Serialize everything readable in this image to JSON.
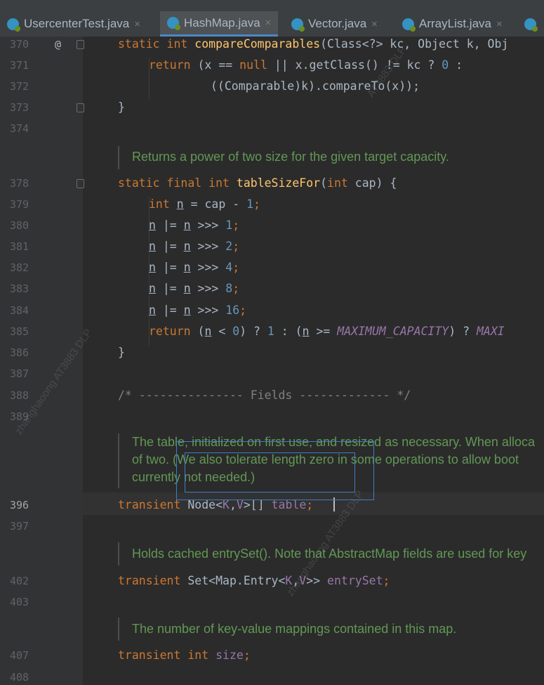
{
  "tabs": [
    {
      "label": "UsercenterTest.java",
      "close": "×",
      "active": false
    },
    {
      "label": "HashMap.java",
      "close": "×",
      "active": true
    },
    {
      "label": "Vector.java",
      "close": "×",
      "active": false
    },
    {
      "label": "ArrayList.java",
      "close": "×",
      "active": false
    }
  ],
  "gutter": {
    "line_numbers": [
      "370",
      "371",
      "372",
      "373",
      "374",
      "378",
      "379",
      "380",
      "381",
      "382",
      "383",
      "384",
      "385",
      "386",
      "387",
      "388",
      "389",
      "396",
      "397",
      "402",
      "403",
      "407",
      "408"
    ],
    "current_line": "396",
    "override_marker": "@"
  },
  "code": {
    "l370": [
      "static int ",
      "compareComparables",
      "(Class<?> kc, Object k, Obj"
    ],
    "l371": [
      "return ",
      "(x == ",
      "null",
      " || x.getClass() != kc ? ",
      "0",
      " :"
    ],
    "l372": [
      "((Comparable)k).compareTo(x));"
    ],
    "l373": [
      "}"
    ],
    "l378": [
      "static final int ",
      "tableSizeFor",
      "(",
      "int ",
      "cap) {"
    ],
    "l379": [
      "int ",
      "n",
      " = cap - ",
      "1",
      ";"
    ],
    "l380": [
      "n",
      " |= ",
      "n",
      " >>> ",
      "1",
      ";"
    ],
    "l381": [
      "n",
      " |= ",
      "n",
      " >>> ",
      "2",
      ";"
    ],
    "l382": [
      "n",
      " |= ",
      "n",
      " >>> ",
      "4",
      ";"
    ],
    "l383": [
      "n",
      " |= ",
      "n",
      " >>> ",
      "8",
      ";"
    ],
    "l384": [
      "n",
      " |= ",
      "n",
      " >>> ",
      "16",
      ";"
    ],
    "l385": [
      "return ",
      "(",
      "n",
      " < ",
      "0",
      ") ? ",
      "1",
      " : (",
      "n",
      " >= ",
      "MAXIMUM_CAPACITY",
      ") ? ",
      "MAXI"
    ],
    "l386": [
      "}"
    ],
    "l388": [
      "/* --------------- Fields ------------- */"
    ],
    "l396": [
      "transient ",
      "Node<",
      "K",
      ",",
      "V",
      ">[] ",
      "table",
      ";"
    ],
    "l402": [
      "transient ",
      "Set<Map.Entry<",
      "K",
      ",",
      "V",
      ">> ",
      "entrySet",
      ";"
    ],
    "l407": [
      "transient int ",
      "size",
      ";"
    ]
  },
  "docs": {
    "d1": [
      "Returns a power of two size for the given target capacity."
    ],
    "d2": [
      "The table, initialized on first use, and resized as necessary. When alloca",
      "of two. (We also tolerate length zero in some operations to allow boot",
      "currently not needed.)"
    ],
    "d3": [
      "Holds cached entrySet(). Note that AbstractMap fields are used for key"
    ],
    "d4": [
      "The number of key-value mappings contained in this map."
    ]
  },
  "watermarks": [
    "zhanghaoong AT3883 DLP",
    "AT3883 DLP",
    "zhanghaoong AT3883 DLP"
  ],
  "colors": {
    "background": "#2b2b2b",
    "keyword": "#cc7832",
    "function": "#ffc66d",
    "number": "#6897bb",
    "field": "#9876aa",
    "doc_comment": "#629755",
    "selection_box": "#3b7fc4"
  }
}
